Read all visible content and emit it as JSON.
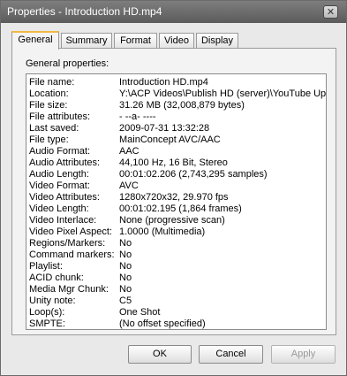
{
  "window": {
    "title": "Properties - Introduction HD.mp4",
    "close_glyph": "✕"
  },
  "tabs": [
    "General",
    "Summary",
    "Format",
    "Video",
    "Display"
  ],
  "section_label": "General properties:",
  "properties": [
    {
      "key": "File name:",
      "value": "Introduction HD.mp4"
    },
    {
      "key": "Location:",
      "value": "Y:\\ACP Videos\\Publish HD (server)\\YouTube Uplo"
    },
    {
      "key": "File size:",
      "value": "31.26 MB (32,008,879 bytes)"
    },
    {
      "key": "File attributes:",
      "value": "- --a- ----"
    },
    {
      "key": "Last saved:",
      "value": "2009-07-31  13:32:28"
    },
    {
      "key": "File type:",
      "value": "MainConcept AVC/AAC"
    },
    {
      "key": "Audio Format:",
      "value": "AAC"
    },
    {
      "key": "Audio Attributes:",
      "value": "44,100 Hz, 16 Bit, Stereo"
    },
    {
      "key": "Audio Length:",
      "value": "00:01:02.206 (2,743,295 samples)"
    },
    {
      "key": "Video Format:",
      "value": "AVC"
    },
    {
      "key": "Video Attributes:",
      "value": "1280x720x32, 29.970 fps"
    },
    {
      "key": "Video Length:",
      "value": "00:01:02.195 (1,864 frames)"
    },
    {
      "key": "Video Interlace:",
      "value": "None (progressive scan)"
    },
    {
      "key": "Video Pixel Aspect:",
      "value": "1.0000 (Multimedia)"
    },
    {
      "key": "Regions/Markers:",
      "value": "No"
    },
    {
      "key": "Command markers:",
      "value": "No"
    },
    {
      "key": "Playlist:",
      "value": "No"
    },
    {
      "key": "ACID chunk:",
      "value": "No"
    },
    {
      "key": "Media Mgr Chunk:",
      "value": "No"
    },
    {
      "key": "Unity note:",
      "value": "C5"
    },
    {
      "key": "Loop(s):",
      "value": "One Shot"
    },
    {
      "key": "SMPTE:",
      "value": "(No offset specified)"
    }
  ],
  "buttons": {
    "ok": "OK",
    "cancel": "Cancel",
    "apply": "Apply"
  }
}
